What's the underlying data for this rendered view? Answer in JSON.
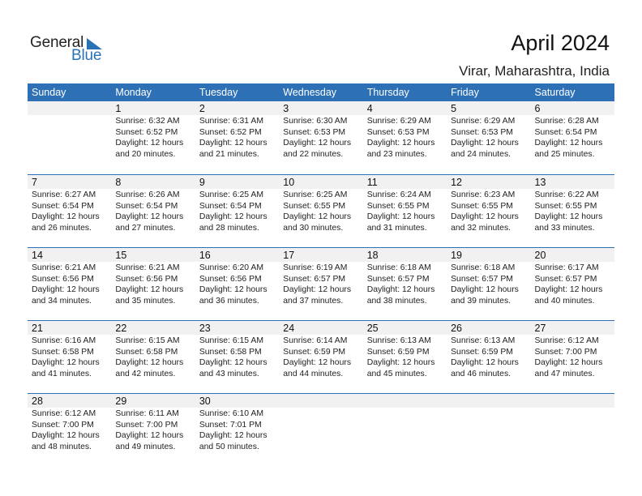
{
  "logo": {
    "word1": "General",
    "word2": "Blue",
    "icon": "triangle-flag-icon",
    "accent": "#2a72b8"
  },
  "header": {
    "title": "April 2024",
    "location": "Virar, Maharashtra, India"
  },
  "colors": {
    "header_bg": "#2e70b5",
    "day_strip_bg": "#f1f1f1"
  },
  "weekdays": [
    "Sunday",
    "Monday",
    "Tuesday",
    "Wednesday",
    "Thursday",
    "Friday",
    "Saturday"
  ],
  "weeks": [
    [
      null,
      {
        "day": "1",
        "sunrise": "Sunrise: 6:32 AM",
        "sunset": "Sunset: 6:52 PM",
        "daylight1": "Daylight: 12 hours",
        "daylight2": "and 20 minutes."
      },
      {
        "day": "2",
        "sunrise": "Sunrise: 6:31 AM",
        "sunset": "Sunset: 6:52 PM",
        "daylight1": "Daylight: 12 hours",
        "daylight2": "and 21 minutes."
      },
      {
        "day": "3",
        "sunrise": "Sunrise: 6:30 AM",
        "sunset": "Sunset: 6:53 PM",
        "daylight1": "Daylight: 12 hours",
        "daylight2": "and 22 minutes."
      },
      {
        "day": "4",
        "sunrise": "Sunrise: 6:29 AM",
        "sunset": "Sunset: 6:53 PM",
        "daylight1": "Daylight: 12 hours",
        "daylight2": "and 23 minutes."
      },
      {
        "day": "5",
        "sunrise": "Sunrise: 6:29 AM",
        "sunset": "Sunset: 6:53 PM",
        "daylight1": "Daylight: 12 hours",
        "daylight2": "and 24 minutes."
      },
      {
        "day": "6",
        "sunrise": "Sunrise: 6:28 AM",
        "sunset": "Sunset: 6:54 PM",
        "daylight1": "Daylight: 12 hours",
        "daylight2": "and 25 minutes."
      }
    ],
    [
      {
        "day": "7",
        "sunrise": "Sunrise: 6:27 AM",
        "sunset": "Sunset: 6:54 PM",
        "daylight1": "Daylight: 12 hours",
        "daylight2": "and 26 minutes."
      },
      {
        "day": "8",
        "sunrise": "Sunrise: 6:26 AM",
        "sunset": "Sunset: 6:54 PM",
        "daylight1": "Daylight: 12 hours",
        "daylight2": "and 27 minutes."
      },
      {
        "day": "9",
        "sunrise": "Sunrise: 6:25 AM",
        "sunset": "Sunset: 6:54 PM",
        "daylight1": "Daylight: 12 hours",
        "daylight2": "and 28 minutes."
      },
      {
        "day": "10",
        "sunrise": "Sunrise: 6:25 AM",
        "sunset": "Sunset: 6:55 PM",
        "daylight1": "Daylight: 12 hours",
        "daylight2": "and 30 minutes."
      },
      {
        "day": "11",
        "sunrise": "Sunrise: 6:24 AM",
        "sunset": "Sunset: 6:55 PM",
        "daylight1": "Daylight: 12 hours",
        "daylight2": "and 31 minutes."
      },
      {
        "day": "12",
        "sunrise": "Sunrise: 6:23 AM",
        "sunset": "Sunset: 6:55 PM",
        "daylight1": "Daylight: 12 hours",
        "daylight2": "and 32 minutes."
      },
      {
        "day": "13",
        "sunrise": "Sunrise: 6:22 AM",
        "sunset": "Sunset: 6:55 PM",
        "daylight1": "Daylight: 12 hours",
        "daylight2": "and 33 minutes."
      }
    ],
    [
      {
        "day": "14",
        "sunrise": "Sunrise: 6:21 AM",
        "sunset": "Sunset: 6:56 PM",
        "daylight1": "Daylight: 12 hours",
        "daylight2": "and 34 minutes."
      },
      {
        "day": "15",
        "sunrise": "Sunrise: 6:21 AM",
        "sunset": "Sunset: 6:56 PM",
        "daylight1": "Daylight: 12 hours",
        "daylight2": "and 35 minutes."
      },
      {
        "day": "16",
        "sunrise": "Sunrise: 6:20 AM",
        "sunset": "Sunset: 6:56 PM",
        "daylight1": "Daylight: 12 hours",
        "daylight2": "and 36 minutes."
      },
      {
        "day": "17",
        "sunrise": "Sunrise: 6:19 AM",
        "sunset": "Sunset: 6:57 PM",
        "daylight1": "Daylight: 12 hours",
        "daylight2": "and 37 minutes."
      },
      {
        "day": "18",
        "sunrise": "Sunrise: 6:18 AM",
        "sunset": "Sunset: 6:57 PM",
        "daylight1": "Daylight: 12 hours",
        "daylight2": "and 38 minutes."
      },
      {
        "day": "19",
        "sunrise": "Sunrise: 6:18 AM",
        "sunset": "Sunset: 6:57 PM",
        "daylight1": "Daylight: 12 hours",
        "daylight2": "and 39 minutes."
      },
      {
        "day": "20",
        "sunrise": "Sunrise: 6:17 AM",
        "sunset": "Sunset: 6:57 PM",
        "daylight1": "Daylight: 12 hours",
        "daylight2": "and 40 minutes."
      }
    ],
    [
      {
        "day": "21",
        "sunrise": "Sunrise: 6:16 AM",
        "sunset": "Sunset: 6:58 PM",
        "daylight1": "Daylight: 12 hours",
        "daylight2": "and 41 minutes."
      },
      {
        "day": "22",
        "sunrise": "Sunrise: 6:15 AM",
        "sunset": "Sunset: 6:58 PM",
        "daylight1": "Daylight: 12 hours",
        "daylight2": "and 42 minutes."
      },
      {
        "day": "23",
        "sunrise": "Sunrise: 6:15 AM",
        "sunset": "Sunset: 6:58 PM",
        "daylight1": "Daylight: 12 hours",
        "daylight2": "and 43 minutes."
      },
      {
        "day": "24",
        "sunrise": "Sunrise: 6:14 AM",
        "sunset": "Sunset: 6:59 PM",
        "daylight1": "Daylight: 12 hours",
        "daylight2": "and 44 minutes."
      },
      {
        "day": "25",
        "sunrise": "Sunrise: 6:13 AM",
        "sunset": "Sunset: 6:59 PM",
        "daylight1": "Daylight: 12 hours",
        "daylight2": "and 45 minutes."
      },
      {
        "day": "26",
        "sunrise": "Sunrise: 6:13 AM",
        "sunset": "Sunset: 6:59 PM",
        "daylight1": "Daylight: 12 hours",
        "daylight2": "and 46 minutes."
      },
      {
        "day": "27",
        "sunrise": "Sunrise: 6:12 AM",
        "sunset": "Sunset: 7:00 PM",
        "daylight1": "Daylight: 12 hours",
        "daylight2": "and 47 minutes."
      }
    ],
    [
      {
        "day": "28",
        "sunrise": "Sunrise: 6:12 AM",
        "sunset": "Sunset: 7:00 PM",
        "daylight1": "Daylight: 12 hours",
        "daylight2": "and 48 minutes."
      },
      {
        "day": "29",
        "sunrise": "Sunrise: 6:11 AM",
        "sunset": "Sunset: 7:00 PM",
        "daylight1": "Daylight: 12 hours",
        "daylight2": "and 49 minutes."
      },
      {
        "day": "30",
        "sunrise": "Sunrise: 6:10 AM",
        "sunset": "Sunset: 7:01 PM",
        "daylight1": "Daylight: 12 hours",
        "daylight2": "and 50 minutes."
      },
      null,
      null,
      null,
      null
    ]
  ]
}
